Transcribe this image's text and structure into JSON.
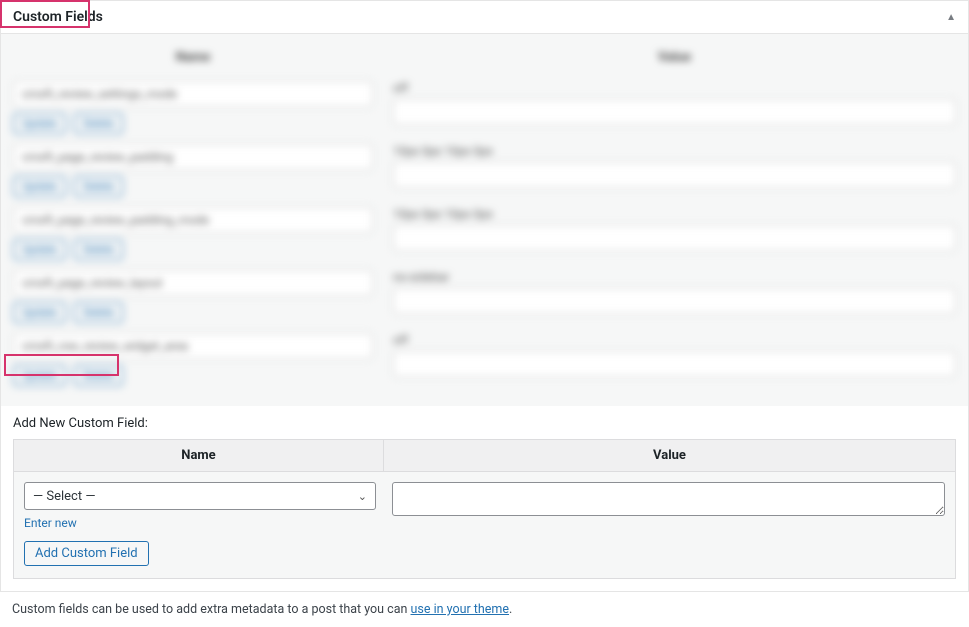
{
  "panel": {
    "title": "Custom Fields"
  },
  "existing": {
    "header_name": "Name",
    "header_value": "Value",
    "rows": [
      {
        "name": "cmsft_review_settings_mode",
        "value": "off",
        "btn1": "Update",
        "btn2": "Delete"
      },
      {
        "name": "cmsft_page_review_padding",
        "value": "10px 0px 10px 0px",
        "btn1": "Update",
        "btn2": "Delete"
      },
      {
        "name": "cmsft_page_review_padding_mode",
        "value": "10px 0px 10px 0px",
        "btn1": "Update",
        "btn2": "Delete"
      },
      {
        "name": "cmsft_page_review_layout",
        "value": "no-sidebar",
        "btn1": "Update",
        "btn2": "Delete"
      },
      {
        "name": "cmsft_row_review_widget_area",
        "value": "off",
        "btn1": "Update",
        "btn2": "Delete"
      }
    ]
  },
  "add": {
    "heading": "Add New Custom Field:",
    "th_name": "Name",
    "th_value": "Value",
    "select_placeholder": "— Select —",
    "enter_new": "Enter new",
    "button": "Add Custom Field"
  },
  "footer": {
    "text_before": "Custom fields can be used to add extra metadata to a post that you can ",
    "link": "use in your theme",
    "text_after": "."
  }
}
